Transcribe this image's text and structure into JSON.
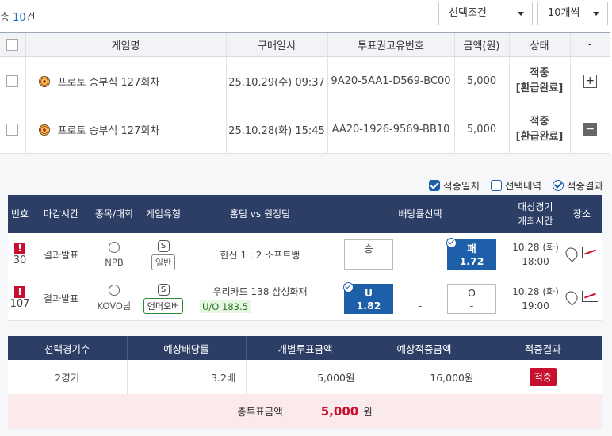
{
  "summary": {
    "prefix": "총 ",
    "count": "10",
    "suffix": "건"
  },
  "filters": {
    "condition": "선택조건",
    "page_size": "10개씩"
  },
  "list": {
    "headers": [
      "게임명",
      "구매일시",
      "투표권고유번호",
      "금액(원)",
      "상태",
      "-"
    ],
    "rows": [
      {
        "game": "프로토 승부식 127회차",
        "date": "25.10.29(수) 09:37",
        "ticket_id": "9A20-5AA1-D569-BC00",
        "amount": "5,000",
        "status1": "적중",
        "status2": "[환급완료]",
        "toggle": "+"
      },
      {
        "game": "프로토 승부식 127회차",
        "date": "25.10.28(화) 15:45",
        "ticket_id": "AA20-1926-9569-BB10",
        "amount": "5,000",
        "status1": "적중",
        "status2": "[환급완료]",
        "toggle": "−"
      }
    ]
  },
  "legend": {
    "match": "적중일치",
    "selection": "선택내역",
    "result": "적중결과"
  },
  "detail": {
    "headers": {
      "no": "번호",
      "deadline": "마감시간",
      "sport": "종목/대회",
      "type": "게임유형",
      "teams": "홈팀 vs 원정팀",
      "odds": "배당률선택",
      "date1": "대상경기",
      "date2": "개최시간",
      "venue": "장소"
    },
    "rows": [
      {
        "no": "30",
        "deadline": "결과발표",
        "league": "NPB",
        "s": "S",
        "type": "일반",
        "home": "한신",
        "score": "1 : 2",
        "away": "소프트뱅",
        "extra": "",
        "o1_label": "승",
        "o1_val": "-",
        "mid": "-",
        "o2_label": "패",
        "o2_val": "1.72",
        "date": "10.28 (화)",
        "time": "18:00"
      },
      {
        "no": "107",
        "deadline": "결과발표",
        "league": "KOVO남",
        "s": "S",
        "type": "언더오버",
        "home": "우리카드",
        "score": "138",
        "away": "삼성화재",
        "extra": "U/O 183.5",
        "o1_label": "U",
        "o1_val": "1.82",
        "mid": "-",
        "o2_label": "O",
        "o2_val": "-",
        "date": "10.28 (화)",
        "time": "19:00"
      }
    ]
  },
  "summary_table": {
    "headers": [
      "선택경기수",
      "예상배당률",
      "개별투표금액",
      "예상적중금액",
      "적중결과"
    ],
    "values": {
      "games": "2경기",
      "odds": "3.2배",
      "bet": "5,000원",
      "payout": "16,000원",
      "result": "적중"
    },
    "total_label": "총투표금액",
    "total_amount": "5,000",
    "total_unit": "원"
  }
}
